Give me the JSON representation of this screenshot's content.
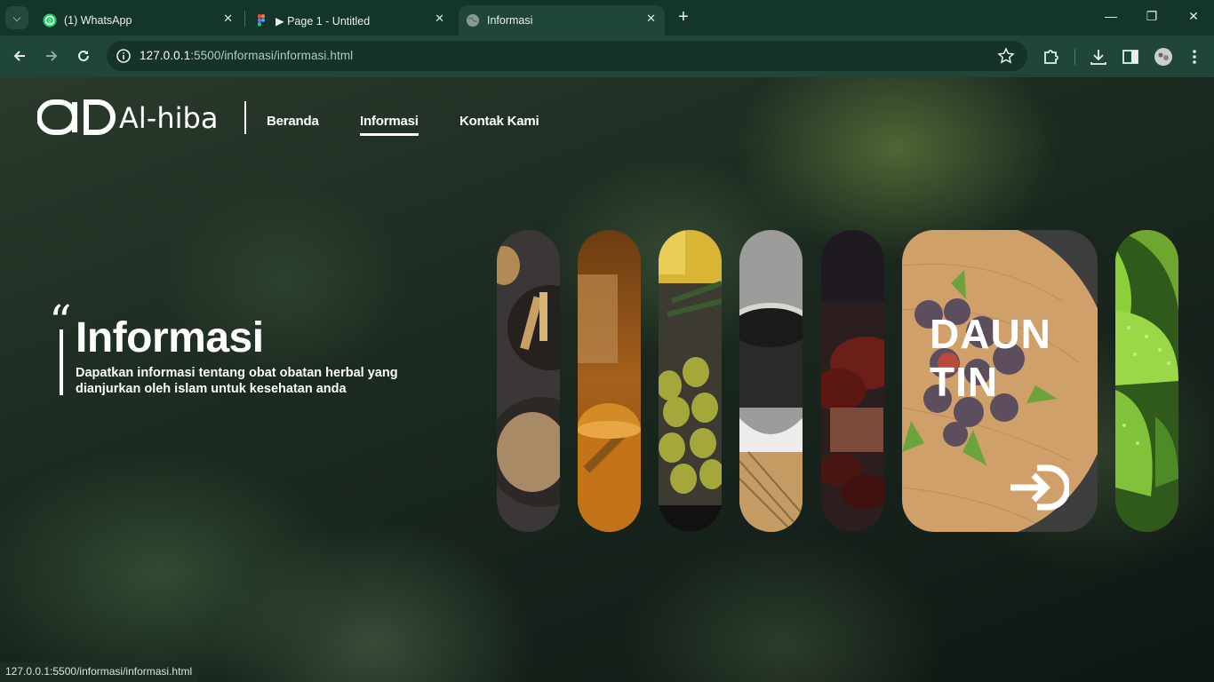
{
  "browser": {
    "tabs": [
      {
        "title": "(1) WhatsApp",
        "icon": "whatsapp-icon",
        "active": false
      },
      {
        "title": "▶ Page 1 - Untitled",
        "icon": "figma-icon",
        "active": false
      },
      {
        "title": "Informasi",
        "icon": "globe-icon",
        "active": true
      }
    ],
    "url_host": "127.0.0.1",
    "url_path": ":5500/informasi/informasi.html",
    "status_url": "127.0.0.1:5500/informasi/informasi.html"
  },
  "site": {
    "brand": "Al-hiba",
    "nav": [
      {
        "label": "Beranda",
        "active": false
      },
      {
        "label": "Informasi",
        "active": true
      },
      {
        "label": "Kontak Kami",
        "active": false
      }
    ]
  },
  "hero": {
    "quote": "“",
    "title": "Informasi",
    "description": "Dapatkan informasi tentang obat obatan herbal yang dianjurkan oleh islam untuk kesehatan anda"
  },
  "gallery": {
    "cards": [
      {
        "name": "card-jahe",
        "icon": "ginger-spices-image"
      },
      {
        "name": "card-madu",
        "icon": "honey-image"
      },
      {
        "name": "card-zaitun",
        "icon": "olive-image"
      },
      {
        "name": "card-habbatussauda",
        "icon": "black-seed-image"
      },
      {
        "name": "card-kurma",
        "icon": "dates-image"
      },
      {
        "name": "card-daun",
        "icon": "green-leaves-image"
      }
    ],
    "featured": {
      "title": "DAUN TIN",
      "icon": "enter-arrow-icon"
    }
  },
  "colors": {
    "chrome_tabbar": "#14352b",
    "chrome_toolbar": "#1f4638",
    "text": "#ffffff"
  }
}
